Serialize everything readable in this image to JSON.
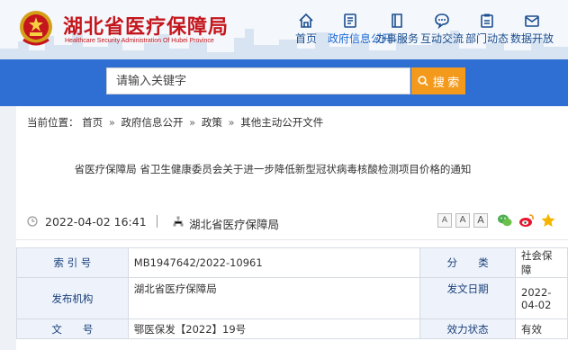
{
  "site": {
    "title": "湖北省医疗保障局",
    "subtitle": "Healthcare Security Administration Of Hubei Province"
  },
  "nav": [
    {
      "label": "首页",
      "icon": "home-icon"
    },
    {
      "label": "政府信息公开",
      "icon": "document-icon",
      "active": true
    },
    {
      "label": "办事服务",
      "icon": "book-icon"
    },
    {
      "label": "互动交流",
      "icon": "chat-icon"
    },
    {
      "label": "部门动态",
      "icon": "clipboard-icon"
    },
    {
      "label": "数据开放",
      "icon": "envelope-icon"
    }
  ],
  "search": {
    "placeholder": "请输入关键字",
    "button_label": "搜 索"
  },
  "breadcrumb": {
    "prefix": "当前位置：",
    "items": [
      "首页",
      "政府信息公开",
      "政策",
      "其他主动公开文件"
    ],
    "separator": "»"
  },
  "article": {
    "title": "省医疗保障局 省卫生健康委员会关于进一步降低新型冠状病毒核酸检测项目价格的通知",
    "date": "2022-04-02 16:41",
    "source": "湖北省医疗保障局",
    "font_sizes": [
      "A",
      "A",
      "A"
    ]
  },
  "info_table": {
    "index_label": "索 引 号",
    "index_value": "MB1947642/2022-10961",
    "category_label": "分　　类",
    "category_value": "社会保障",
    "issuer_label": "发布机构",
    "issuer_value": "湖北省医疗保障局",
    "issue_date_label": "发文日期",
    "issue_date_line1": "2022-",
    "issue_date_line2": "04-02",
    "doc_no_label": "文　　号",
    "doc_no_value": "鄂医保发【2022】19号",
    "status_label": "效力状态",
    "status_value": "有效"
  },
  "colors": {
    "brand_red": "#c4161c",
    "nav_blue": "#1a4d8f",
    "search_band": "#2f6fd3",
    "search_button": "#f39a1d"
  }
}
